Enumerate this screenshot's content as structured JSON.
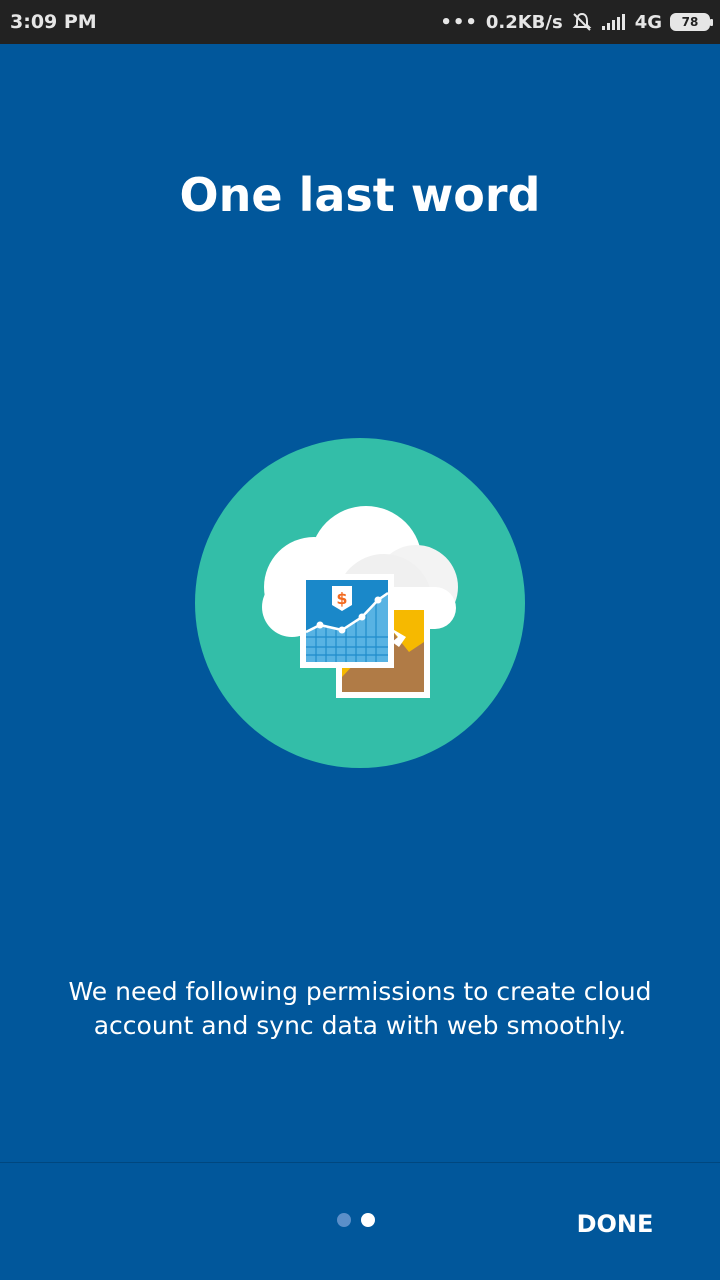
{
  "status_bar": {
    "time": "3:09 PM",
    "dots": "•••",
    "network_speed": "0.2KB/s",
    "network_type": "4G",
    "battery": "78",
    "icons": [
      "notifications-muted-icon",
      "signal-icon",
      "battery-icon"
    ]
  },
  "onboarding": {
    "title": "One last word",
    "description": "We need following permissions to create cloud account and sync data with web smoothly.",
    "illustration_icon": "cloud-sync-icon",
    "page_indicator": {
      "total": 2,
      "active": 2
    },
    "done_label": "DONE"
  },
  "colors": {
    "background": "#01579b",
    "status_bar": "#222222",
    "circle": "#33bea8",
    "cloud": "#ececec",
    "chart_card": "#1a88c9",
    "image_card": "#f6b900",
    "mountain": "#b07b46",
    "dollar": "#f26b21"
  }
}
